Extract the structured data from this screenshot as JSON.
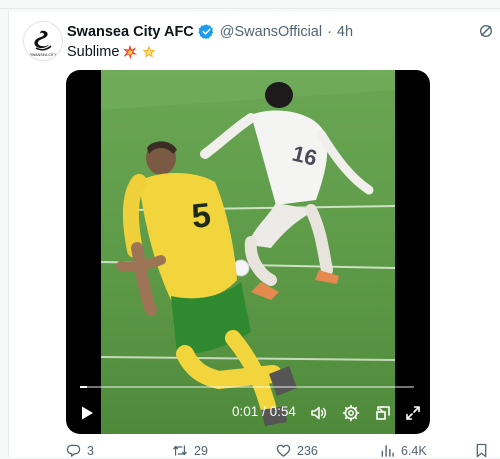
{
  "author": {
    "display_name": "Swansea City AFC",
    "handle": "@SwansOfficial",
    "time_sep": "·",
    "time": "4h",
    "avatar_text": "SWANSEA CITY"
  },
  "tweet": {
    "text": "Sublime",
    "emojis": [
      "collision-emoji",
      "glowing-star-emoji"
    ]
  },
  "video": {
    "current_time": "0:01",
    "separator": "/",
    "duration": "0:54",
    "progress": 0.02,
    "player_number": "5",
    "controls": [
      "play-icon",
      "volume-icon",
      "settings-icon",
      "picture-in-picture-icon",
      "fullscreen-icon"
    ]
  },
  "actions": {
    "replies": "3",
    "reposts": "29",
    "likes": "236",
    "views": "6.4K"
  },
  "colors": {
    "verified": "#1d9bf0",
    "grass": "#5f9a4c",
    "yellow_kit": "#f2d53c",
    "green_shorts": "#2f8a2f"
  }
}
